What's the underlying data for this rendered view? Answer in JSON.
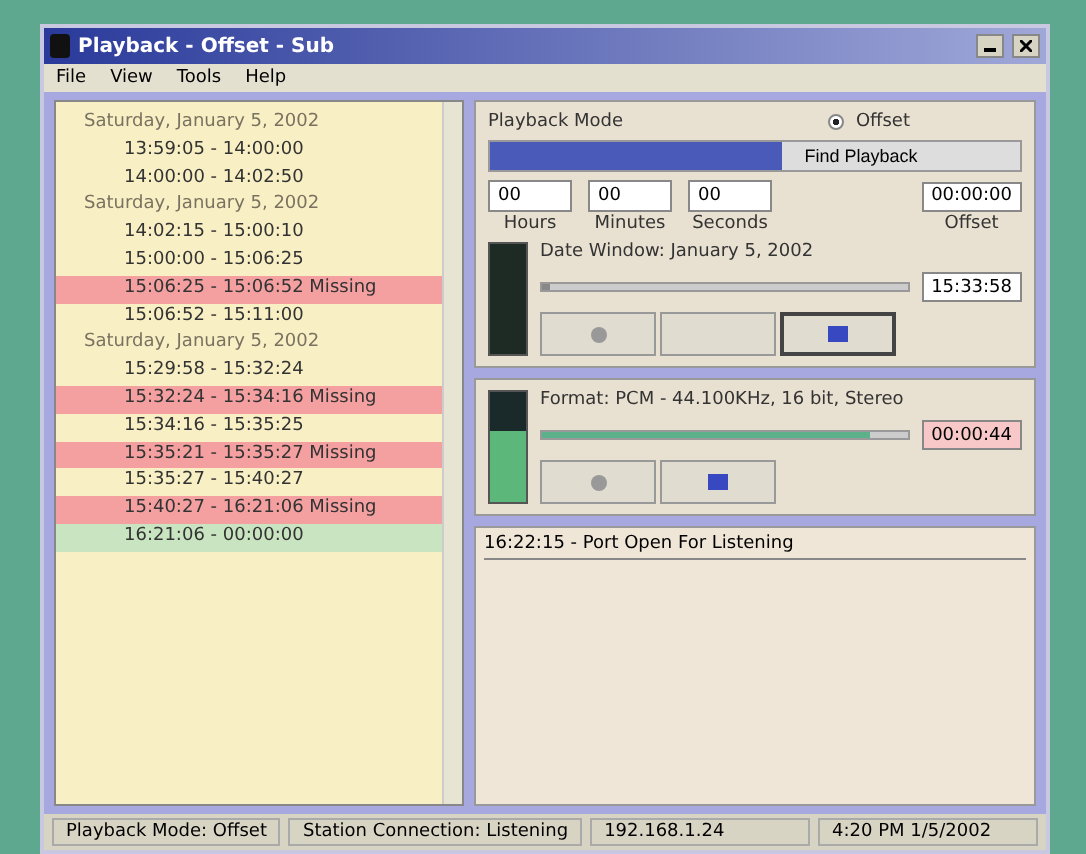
{
  "window": {
    "title": "Playback - Offset - Sub"
  },
  "menu": [
    "File",
    "View",
    "Tools",
    "Help"
  ],
  "log_list": [
    {
      "kind": "header",
      "text": "Saturday, January 5, 2002"
    },
    {
      "kind": "normal",
      "text": "13:59:05 - 14:00:00"
    },
    {
      "kind": "normal",
      "text": "14:00:00 - 14:02:50"
    },
    {
      "kind": "header",
      "text": "Saturday, January 5, 2002"
    },
    {
      "kind": "normal",
      "text": "14:02:15 - 15:00:10"
    },
    {
      "kind": "normal",
      "text": "15:00:00 - 15:06:25"
    },
    {
      "kind": "missing",
      "text": "15:06:25 - 15:06:52 Missing"
    },
    {
      "kind": "normal",
      "text": "15:06:52 - 15:11:00"
    },
    {
      "kind": "header",
      "text": "Saturday, January 5, 2002"
    },
    {
      "kind": "normal",
      "text": "15:29:58 - 15:32:24"
    },
    {
      "kind": "missing",
      "text": "15:32:24 - 15:34:16 Missing"
    },
    {
      "kind": "normal",
      "text": "15:34:16 - 15:35:25"
    },
    {
      "kind": "missing",
      "text": "15:35:21 - 15:35:27 Missing"
    },
    {
      "kind": "normal",
      "text": "15:35:27 - 15:40:27"
    },
    {
      "kind": "missing",
      "text": "15:40:27 - 16:21:06 Missing"
    },
    {
      "kind": "current",
      "text": "16:21:06 - 00:00:00"
    }
  ],
  "playback": {
    "mode_label": "Playback Mode",
    "modes": [
      {
        "label": "Offset",
        "selected": true
      }
    ],
    "find_button": {
      "label": "Find Playback",
      "level": 0.55
    },
    "spinners": [
      {
        "value": "00",
        "label": "Hours"
      },
      {
        "value": "00",
        "label": "Minutes"
      },
      {
        "value": "00",
        "label": "Seconds"
      }
    ],
    "offset": {
      "value": "00:00:00",
      "label": "Offset"
    },
    "date_window": "Date Window: January 5, 2002",
    "slider": {
      "level": 0.02
    },
    "time": "15:33:58",
    "buttons": [
      {
        "kind": "play",
        "selected": false
      },
      {
        "kind": "blank",
        "selected": false
      },
      {
        "kind": "stop",
        "selected": true
      }
    ]
  },
  "recorder": {
    "format": "Format: PCM - 44.100KHz, 16 bit, Stereo",
    "progress": {
      "level": 0.9
    },
    "time": "00:00:44",
    "buttons": [
      {
        "kind": "record",
        "selected": false
      },
      {
        "kind": "stop",
        "selected": false
      }
    ]
  },
  "message_log": [
    "16:22:15 - Port Open For Listening"
  ],
  "status_bar": [
    "Playback Mode: Offset",
    "Station Connection: Listening",
    "192.168.1.24",
    "4:20 PM  1/5/2002"
  ]
}
